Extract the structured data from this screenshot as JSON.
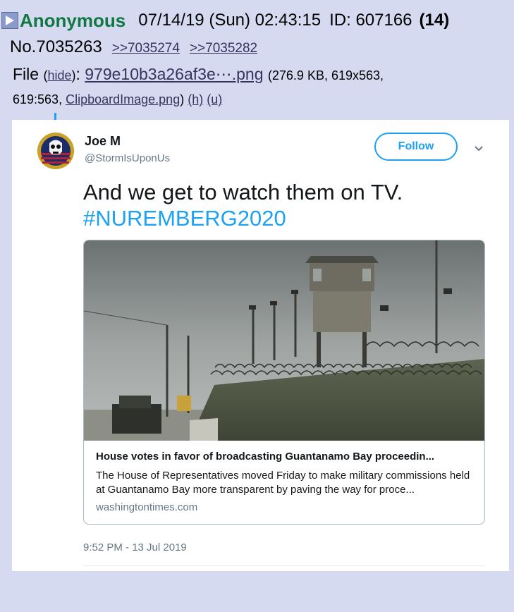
{
  "post": {
    "name": "Anonymous",
    "date": "07/14/19 (Sun) 02:43:15",
    "id": "ID: 607166",
    "count": "(14)",
    "number": "No.7035263",
    "backlinks": [
      ">>7035274",
      ">>7035282"
    ],
    "file": {
      "label": "File",
      "hide": "hide",
      "filename": "979e10b3a26af3e⋯.png",
      "size_info": "(276.9 KB, 619x563,",
      "aspect": "619:563,",
      "original_name": "ClipboardImage.png",
      "h": "(h)",
      "u": "(u)"
    }
  },
  "tweet": {
    "display_name": "Joe M",
    "handle": "@StormIsUponUs",
    "follow_label": "Follow",
    "text": "And we get to watch them on TV.",
    "hashtag": "#NUREMBERG2020",
    "timestamp": "9:52 PM - 13 Jul 2019",
    "card": {
      "title": "House votes in favor of broadcasting Guantanamo Bay proceedin...",
      "description": "The House of Representatives moved Friday to make military commissions held at Guantanamo Bay more transparent by paving the way for proce...",
      "domain": "washingtontimes.com"
    }
  },
  "colors": {
    "background": "#d6daf0",
    "name_green": "#117743",
    "link": "#34345c",
    "twitter_blue": "#1da1f2"
  },
  "icons": {
    "expand": "expand-arrow-icon",
    "avatar": "punisher-skull-avatar",
    "chevron": "chevron-down-icon"
  }
}
